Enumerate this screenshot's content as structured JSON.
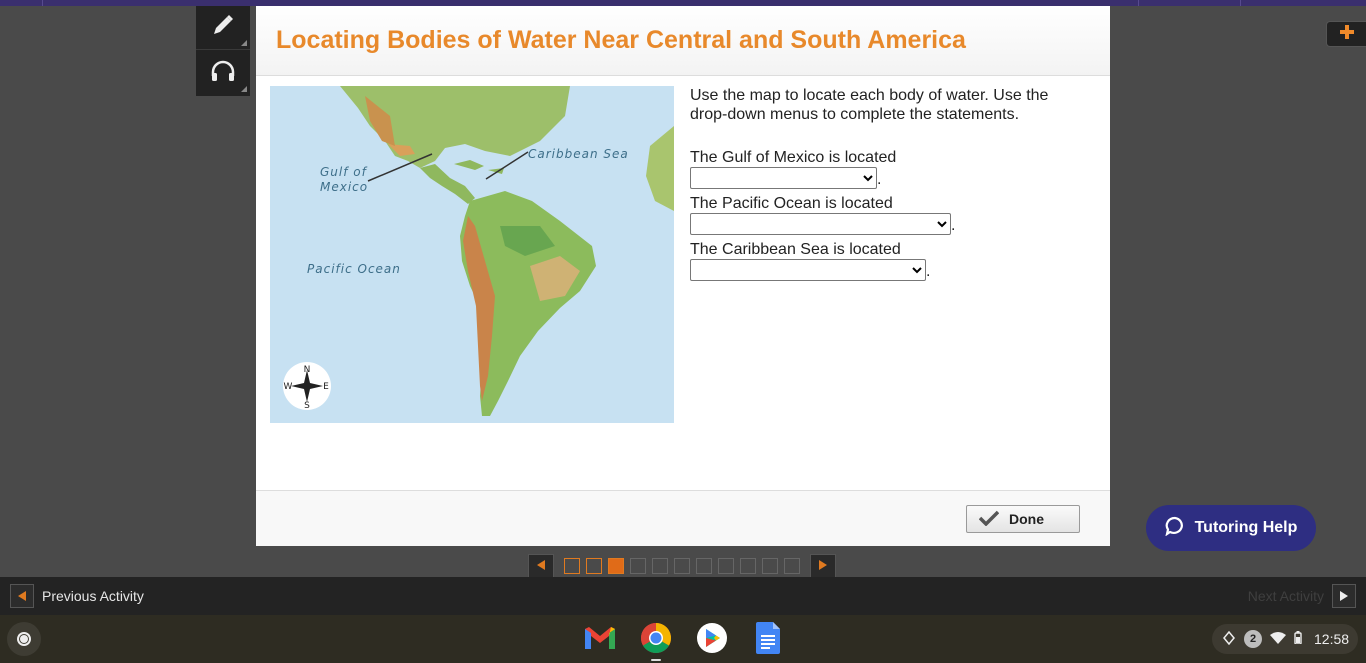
{
  "header": {
    "title": "Locating Bodies of Water Near Central and South America"
  },
  "toolbar": {
    "pencil_icon": "pencil-icon",
    "headphones_icon": "headphones-icon",
    "plus_icon": "plus-icon"
  },
  "map": {
    "labels": {
      "gulf_line1": "Gulf of",
      "gulf_line2": "Mexico",
      "caribbean": "Caribbean Sea",
      "pacific": "Pacific Ocean"
    },
    "compass": {
      "n": "N",
      "s": "S",
      "e": "E",
      "w": "W"
    }
  },
  "question": {
    "instructions": "Use the map to locate each body of water. Use the drop-down menus to complete the statements.",
    "items": [
      {
        "label": "The Gulf of Mexico is located",
        "value": "",
        "period": "."
      },
      {
        "label": "The Pacific Ocean is located",
        "value": "",
        "period": "."
      },
      {
        "label": "The Caribbean Sea is located",
        "value": "",
        "period": "."
      }
    ]
  },
  "footer": {
    "done_label": "Done"
  },
  "tutoring": {
    "label": "Tutoring Help"
  },
  "pager": {
    "total": 11,
    "current": 3,
    "completed": [
      1,
      2
    ]
  },
  "activity_nav": {
    "previous_label": "Previous Activity",
    "next_label": "Next Activity"
  },
  "system_tray": {
    "notification_count": "2",
    "time": "12:58"
  },
  "colors": {
    "title": "#e8892b",
    "tutor_button": "#2e2e82",
    "pager_active": "#e06b18"
  }
}
